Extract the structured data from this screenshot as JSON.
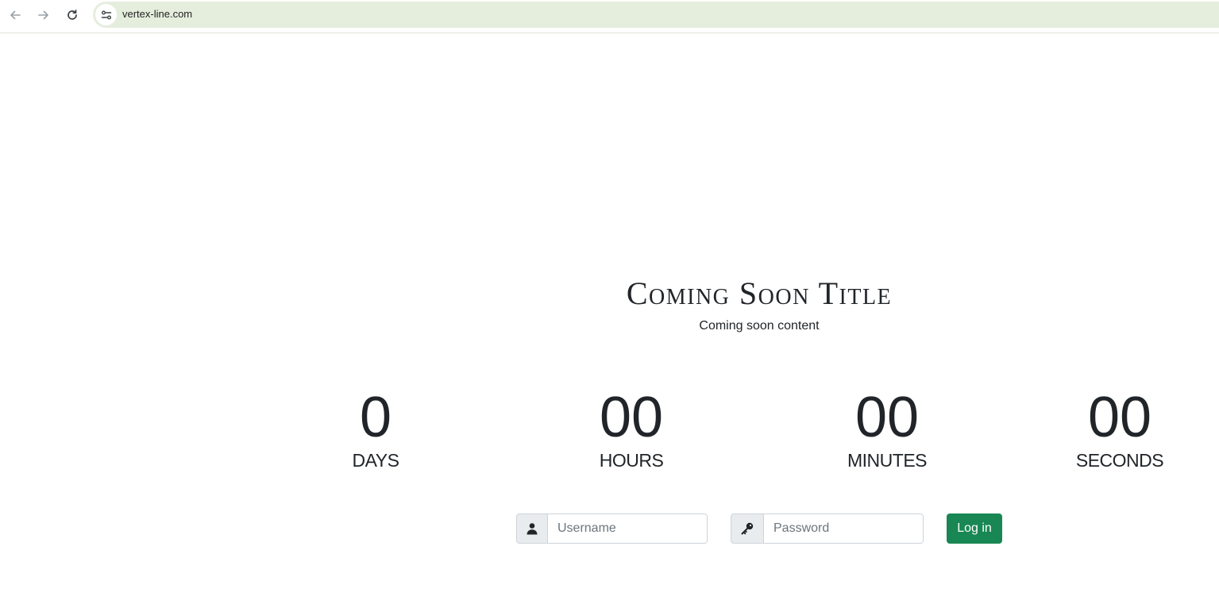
{
  "browser": {
    "url": "vertex-line.com",
    "icons": [
      "back-arrow-icon",
      "forward-arrow-icon",
      "reload-icon",
      "site-info-icon"
    ]
  },
  "page": {
    "title": "Coming Soon Title",
    "subtitle": "Coming soon content"
  },
  "countdown": {
    "days": {
      "value": "0",
      "label": "DAYS"
    },
    "hours": {
      "value": "00",
      "label": "HOURS"
    },
    "minutes": {
      "value": "00",
      "label": "MINUTES"
    },
    "seconds": {
      "value": "00",
      "label": "SECONDS"
    }
  },
  "login": {
    "username_placeholder": "Username",
    "username_icon": "user-icon",
    "password_placeholder": "Password",
    "password_icon": "key-icon",
    "button_label": "Log in",
    "button_color": "#198754"
  },
  "colors": {
    "omnibox": "#e5eedd",
    "text": "#212529"
  }
}
